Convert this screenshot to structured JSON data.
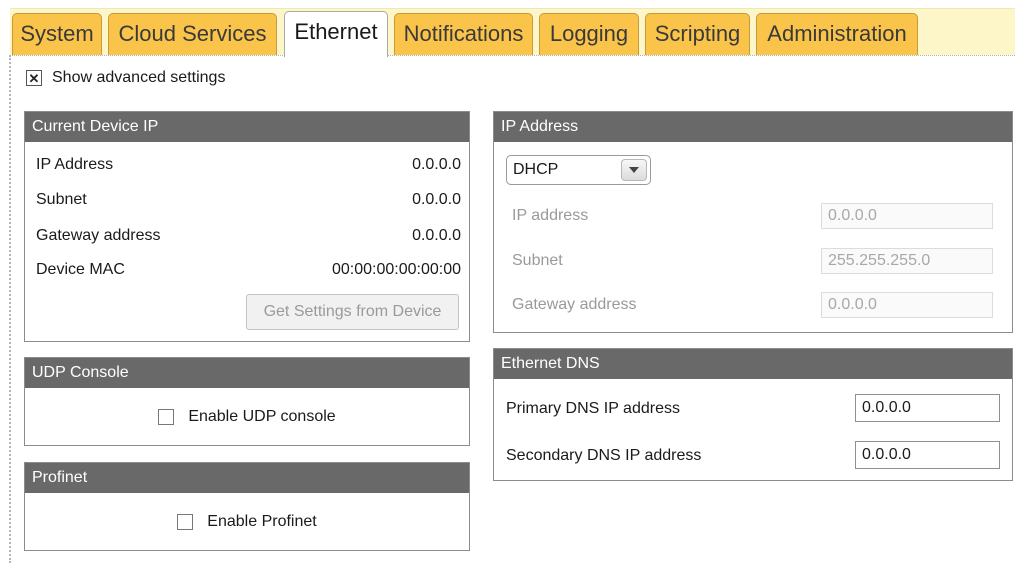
{
  "tabs": [
    {
      "label": "System"
    },
    {
      "label": "Cloud Services"
    },
    {
      "label": "Ethernet"
    },
    {
      "label": "Notifications"
    },
    {
      "label": "Logging"
    },
    {
      "label": "Scripting"
    },
    {
      "label": "Administration"
    }
  ],
  "active_tab": "Ethernet",
  "advanced": {
    "label": "Show advanced settings",
    "checked": true,
    "mark": "✕"
  },
  "current_ip": {
    "title": "Current Device IP",
    "rows": [
      {
        "label": "IP Address",
        "value": "0.0.0.0"
      },
      {
        "label": "Subnet",
        "value": "0.0.0.0"
      },
      {
        "label": "Gateway address",
        "value": "0.0.0.0"
      },
      {
        "label": "Device MAC",
        "value": "00:00:00:00:00:00"
      }
    ],
    "button_label": "Get Settings from Device"
  },
  "udp": {
    "title": "UDP Console",
    "checkbox_label": "Enable UDP console",
    "checked": false
  },
  "profinet": {
    "title": "Profinet",
    "checkbox_label": "Enable Profinet",
    "checked": false
  },
  "ip_address": {
    "title": "IP Address",
    "mode_selected": "DHCP",
    "fields": [
      {
        "label": "IP address",
        "value": "0.0.0.0"
      },
      {
        "label": "Subnet",
        "value": "255.255.255.0"
      },
      {
        "label": "Gateway address",
        "value": "0.0.0.0"
      }
    ]
  },
  "dns": {
    "title": "Ethernet DNS",
    "fields": [
      {
        "label": "Primary DNS IP address",
        "value": "0.0.0.0"
      },
      {
        "label": "Secondary DNS IP address",
        "value": "0.0.0.0"
      }
    ]
  },
  "colors": {
    "tab_bg": "#fac34a",
    "tabstrip_bg": "#fdf6c9",
    "panel_header": "#696969"
  }
}
